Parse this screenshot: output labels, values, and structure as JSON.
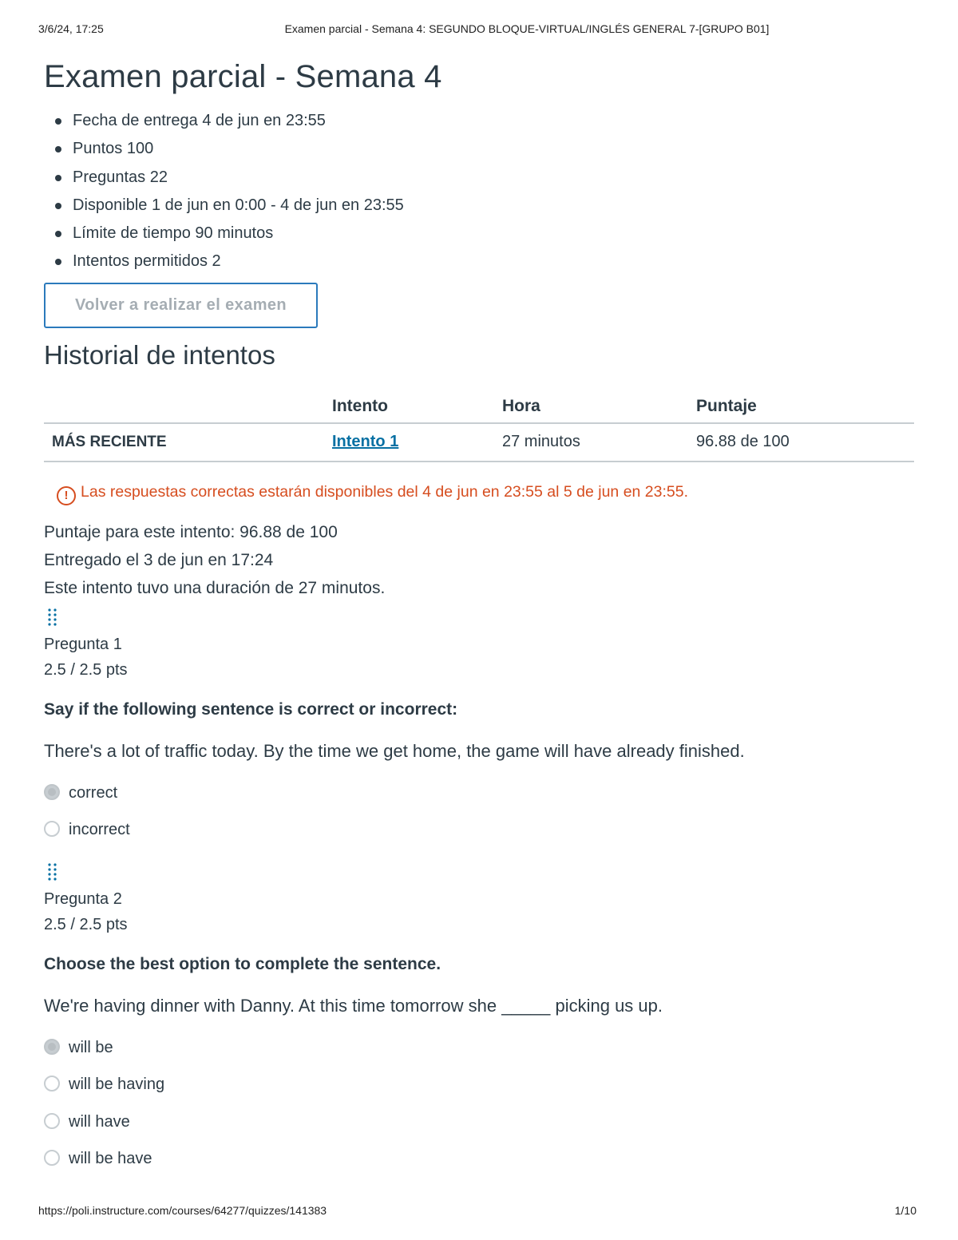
{
  "print": {
    "date": "3/6/24, 17:25",
    "doc_title": "Examen parcial - Semana 4: SEGUNDO BLOQUE-VIRTUAL/INGLÉS GENERAL 7-[GRUPO B01]",
    "url": "https://poli.instructure.com/courses/64277/quizzes/141383",
    "page": "1/10"
  },
  "title": "Examen parcial - Semana 4",
  "details": [
    "Fecha de entrega 4 de jun en 23:55",
    "Puntos 100",
    "Preguntas 22",
    "Disponible 1 de jun en 0:00 - 4 de jun en 23:55",
    "Límite de tiempo 90 minutos",
    "Intentos permitidos 2"
  ],
  "retake_button": "Volver a realizar el examen",
  "history": {
    "heading": "Historial de intentos",
    "columns": [
      "",
      "Intento",
      "Hora",
      "Puntaje"
    ],
    "rows": [
      {
        "label": "MÁS RECIENTE",
        "attempt": "Intento 1",
        "time": "27 minutos",
        "score": "96.88 de 100"
      }
    ]
  },
  "notice": "Las respuestas correctas estarán disponibles del 4 de jun en 23:55 al 5 de jun en 23:55.",
  "summary": {
    "score": "Puntaje para este intento: 96.88 de 100",
    "submitted": "Entregado el 3 de jun en 17:24",
    "duration": "Este intento tuvo una duración de 27 minutos."
  },
  "questions": [
    {
      "number": "Pregunta 1",
      "points": "2.5 / 2.5 pts",
      "prompt": "Say if the following sentence is correct or incorrect:",
      "text": "There's a lot of traffic today. By the time we get home, the game will have already finished.",
      "answers": [
        {
          "label": "correct",
          "selected": true
        },
        {
          "label": "incorrect",
          "selected": false
        }
      ]
    },
    {
      "number": "Pregunta 2",
      "points": "2.5 / 2.5 pts",
      "prompt": "Choose the best option to complete the sentence.",
      "text": "We're having dinner with Danny. At this time tomorrow she _____ picking us up.",
      "answers": [
        {
          "label": "will be",
          "selected": true
        },
        {
          "label": "will be having",
          "selected": false
        },
        {
          "label": "will have",
          "selected": false
        },
        {
          "label": "will be have",
          "selected": false
        }
      ]
    }
  ],
  "colors": {
    "text": "#2d3b45",
    "link": "#0770a3",
    "warning": "#d64d1f",
    "button_border": "#2b7abc"
  }
}
